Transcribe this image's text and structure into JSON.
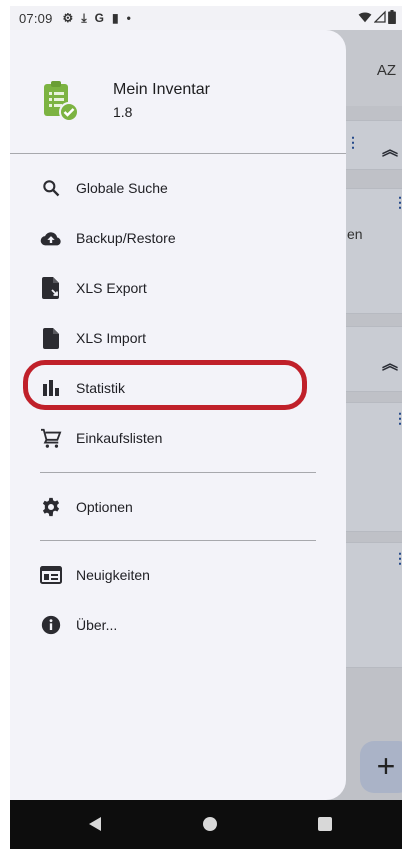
{
  "status_bar": {
    "time": "07:09",
    "notification_icons": [
      "gear-icon",
      "download-icon",
      "google-icon",
      "sd-card-icon",
      "dot-icon"
    ],
    "system_icons": [
      "wifi-icon",
      "signal-icon",
      "battery-icon"
    ]
  },
  "drawer": {
    "app_name": "Mein Inventar",
    "app_version": "1.8",
    "logo_icon": "inventory-clipboard-check-icon",
    "items": [
      {
        "label": "Globale Suche",
        "icon": "search-icon"
      },
      {
        "label": "Backup/Restore",
        "icon": "cloud-upload-icon"
      },
      {
        "label": "XLS Export",
        "icon": "file-export-icon"
      },
      {
        "label": "XLS Import",
        "icon": "file-icon"
      },
      {
        "label": "Statistik",
        "icon": "bar-chart-icon",
        "highlighted": true
      },
      {
        "label": "Einkaufslisten",
        "icon": "shopping-cart-icon"
      },
      {
        "label": "Optionen",
        "icon": "gear-icon"
      },
      {
        "label": "Neuigkeiten",
        "icon": "news-icon"
      },
      {
        "label": "Über...",
        "icon": "info-icon"
      }
    ],
    "highlight_color": "#c0202a"
  },
  "background": {
    "sort_label": "AZ",
    "partial_text": "en",
    "fab_label": "+"
  },
  "colors": {
    "drawer_bg": "#f3f3f9",
    "logo_green": "#7cb342",
    "icon_dark": "#2b2b31"
  }
}
